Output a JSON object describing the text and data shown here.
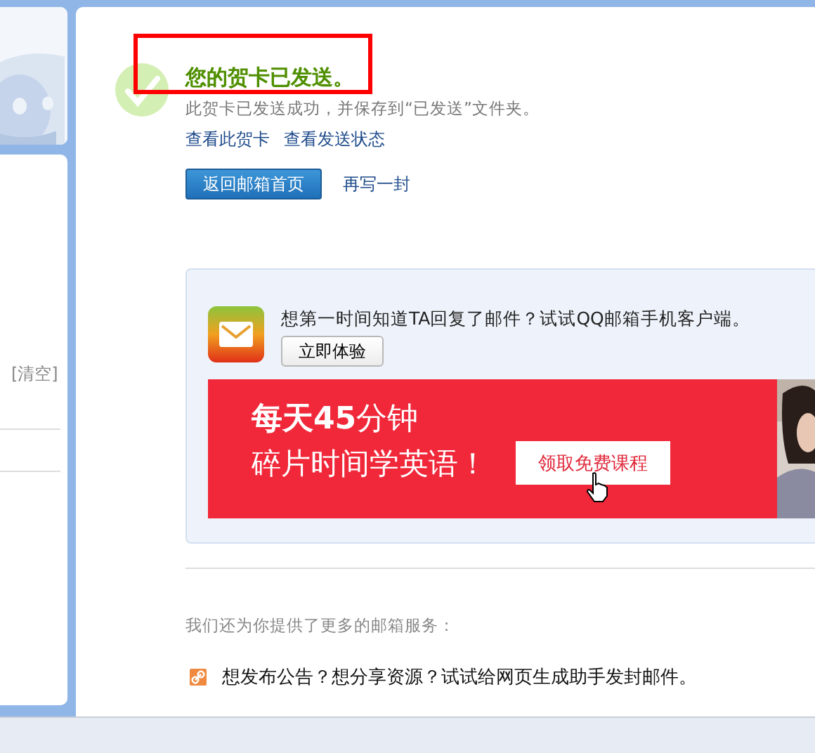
{
  "sidebar": {
    "clear_link": "[清空]"
  },
  "result": {
    "title": "您的贺卡已发送。",
    "highlighted": true,
    "message": "此贺卡已发送成功，并保存到“已发送”文件夹。",
    "links": [
      "查看此贺卡",
      "查看发送状态"
    ],
    "primary_button": "返回邮箱首页",
    "secondary_link": "再写一封"
  },
  "promo": {
    "text": "想第一时间知道TA回复了邮件？试试QQ邮箱手机客户端。",
    "button": "立即体验",
    "banner": {
      "headline": "**每天45**分钟",
      "subline": "碎片时间学英语！",
      "button": "领取免费课程"
    }
  },
  "services": {
    "intro": "我们还为你提供了更多的邮箱服务：",
    "items": [
      {
        "text": "想发布公告？想分享资源？试试给网页生成助手发封邮件。"
      }
    ]
  }
}
